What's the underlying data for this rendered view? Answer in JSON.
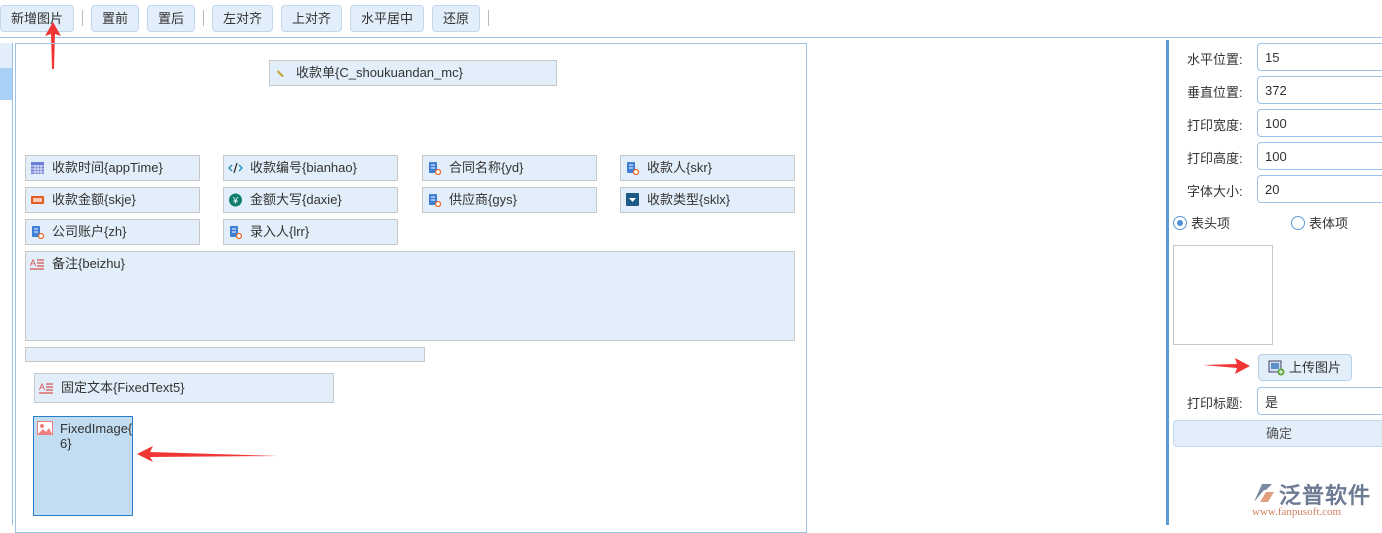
{
  "toolbar": {
    "buttons": [
      "新增图片",
      "置前",
      "置后",
      "左对齐",
      "上对齐",
      "水平居中",
      "还原"
    ]
  },
  "canvas": {
    "title_field": "收款单{C_shoukuandan_mc}",
    "fields": [
      {
        "label": "收款时间{appTime}",
        "icon": "calendar-icon"
      },
      {
        "label": "收款编号{bianhao}",
        "icon": "code-icon"
      },
      {
        "label": "合同名称{yd}",
        "icon": "user-doc-icon"
      },
      {
        "label": "收款人{skr}",
        "icon": "user-doc-icon"
      },
      {
        "label": "收款金额{skje}",
        "icon": "number-icon"
      },
      {
        "label": "金额大写{daxie}",
        "icon": "yen-icon"
      },
      {
        "label": "供应商{gys}",
        "icon": "user-doc-icon"
      },
      {
        "label": "收款类型{sklx}",
        "icon": "dropdown-icon"
      },
      {
        "label": "公司账户{zh}",
        "icon": "user-doc-icon"
      },
      {
        "label": "录入人{lrr}",
        "icon": "user-doc-icon"
      }
    ],
    "remark": "备注{beizhu}",
    "fixed_text": "固定文本{FixedText5}",
    "fixed_image_line1": "FixedImage{",
    "fixed_image_line2": "6}"
  },
  "panel": {
    "fields": [
      {
        "label": "水平位置:",
        "value": "15"
      },
      {
        "label": "垂直位置:",
        "value": "372"
      },
      {
        "label": "打印宽度:",
        "value": "100"
      },
      {
        "label": "打印高度:",
        "value": "100"
      },
      {
        "label": "字体大小:",
        "value": "20"
      }
    ],
    "radio_header": "表头项",
    "radio_body": "表体项",
    "upload_label": "上传图片",
    "print_title_label": "打印标题:",
    "print_title_value": "是",
    "confirm_label": "确定"
  },
  "logo": {
    "name": "泛普软件",
    "url": "www.fanpusoft.com"
  },
  "colors": {
    "accent": "#5b9bd5",
    "field_bg": "#e2eef9",
    "arrow": "#f03535"
  }
}
